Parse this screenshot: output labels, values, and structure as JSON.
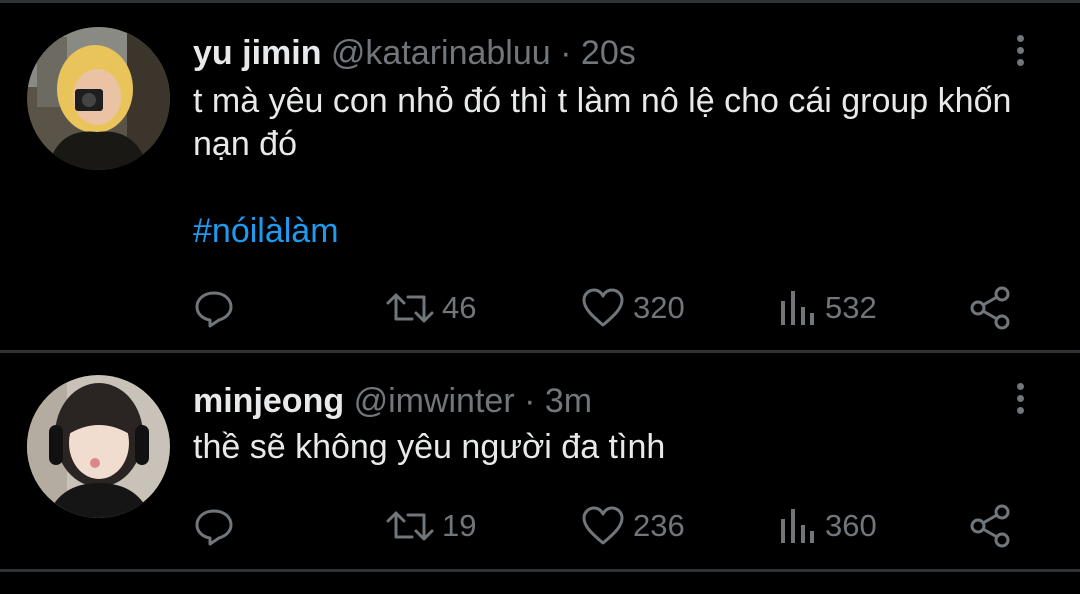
{
  "tweets": [
    {
      "name": "yu jimin",
      "handle": "@katarinabluu",
      "separator": "·",
      "time": "20s",
      "text": "t mà yêu con nhỏ đó thì t làm nô lệ cho cái group khốn nạn đó",
      "hashtag": "#nóilàlàm",
      "retweets": "46",
      "likes": "320",
      "views": "532"
    },
    {
      "name": "minjeong",
      "handle": "@imwinter",
      "separator": "·",
      "time": "3m",
      "text": "thề sẽ không yêu người đa tình",
      "retweets": "19",
      "likes": "236",
      "views": "360"
    }
  ],
  "icons": {
    "reply": "reply-icon",
    "retweet": "retweet-icon",
    "like": "heart-icon",
    "views": "views-icon",
    "share": "share-icon",
    "more": "more-vertical-icon"
  },
  "colors": {
    "background": "#000000",
    "text": "#e7e9ea",
    "muted": "#71767b",
    "link": "#1d9bf0",
    "divider": "#2f3336"
  }
}
